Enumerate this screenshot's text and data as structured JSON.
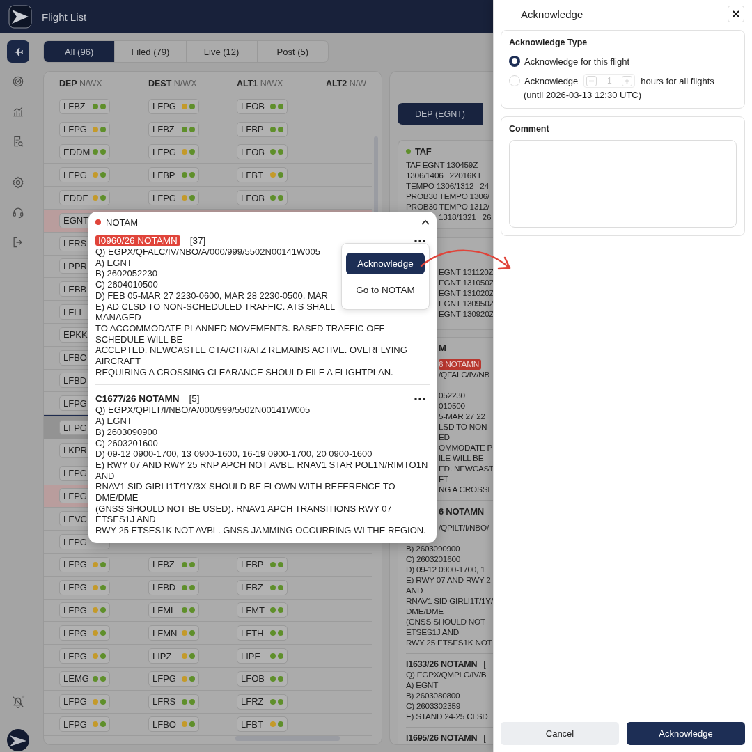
{
  "app": {
    "title": "Flight List"
  },
  "sidebar": {
    "items": [
      {
        "selected": true
      },
      {
        "selected": false
      },
      {
        "selected": false
      },
      {
        "selected": false
      },
      {
        "selected": false
      },
      {
        "selected": false
      },
      {
        "selected": false
      }
    ]
  },
  "filter_tabs": [
    {
      "label": "All (96)",
      "selected": true
    },
    {
      "label": "Filed (79)",
      "selected": false
    },
    {
      "label": "Live (12)",
      "selected": false
    },
    {
      "label": "Post (5)",
      "selected": false
    }
  ],
  "table": {
    "columns": [
      {
        "label": "DEP",
        "sub": "N/WX"
      },
      {
        "label": "DEST",
        "sub": "N/WX"
      },
      {
        "label": "ALT1",
        "sub": "N/WX"
      },
      {
        "label": "ALT2",
        "sub": "N/W"
      }
    ],
    "rows": [
      {
        "kind": "flight",
        "flagged": false,
        "selected": false,
        "cells": [
          {
            "code": "LFBZ",
            "dots": [
              {
                "color": "#5f8f2b"
              },
              {
                "color": "#5f8f2b"
              }
            ]
          },
          {
            "code": "LFPG",
            "dots": [
              {
                "color": "#c49a2a"
              },
              {
                "color": "#5f8f2b"
              }
            ]
          },
          {
            "code": "LFOB",
            "dots": [
              {
                "color": "#5f8f2b"
              },
              {
                "color": "#5f8f2b"
              }
            ]
          }
        ]
      },
      {
        "kind": "flight",
        "flagged": false,
        "selected": false,
        "cells": [
          {
            "code": "LFPG",
            "dots": [
              {
                "color": "#c49a2a"
              },
              {
                "color": "#5f8f2b"
              }
            ]
          },
          {
            "code": "LFBZ",
            "dots": [
              {
                "color": "#5f8f2b"
              },
              {
                "color": "#5f8f2b"
              }
            ]
          },
          {
            "code": "LFBP",
            "dots": [
              {
                "color": "#5f8f2b"
              },
              {
                "color": "#5f8f2b"
              }
            ]
          }
        ]
      },
      {
        "kind": "flight",
        "flagged": false,
        "selected": false,
        "cells": [
          {
            "code": "EDDM",
            "dots": [
              {
                "color": "#5f8f2b"
              },
              {
                "color": "#5f8f2b"
              }
            ]
          },
          {
            "code": "LFPG",
            "dots": [
              {
                "color": "#c49a2a"
              },
              {
                "color": "#5f8f2b"
              }
            ]
          },
          {
            "code": "LFOB",
            "dots": [
              {
                "color": "#5f8f2b"
              },
              {
                "color": "#5f8f2b"
              }
            ]
          }
        ]
      },
      {
        "kind": "flight",
        "flagged": false,
        "selected": false,
        "cells": [
          {
            "code": "LFPG",
            "dots": [
              {
                "color": "#c49a2a"
              },
              {
                "color": "#5f8f2b"
              }
            ]
          },
          {
            "code": "LFBP",
            "dots": [
              {
                "color": "#5f8f2b"
              },
              {
                "color": "#5f8f2b"
              }
            ]
          },
          {
            "code": "LFBT",
            "dots": [
              {
                "color": "#c49a2a"
              },
              {
                "color": "#5f8f2b"
              }
            ]
          }
        ]
      },
      {
        "kind": "flight",
        "flagged": false,
        "selected": false,
        "cells": [
          {
            "code": "EDDF",
            "dots": [
              {
                "color": "#c49a2a"
              },
              {
                "color": "#5f8f2b"
              }
            ]
          },
          {
            "code": "LFPG",
            "dots": [
              {
                "color": "#c49a2a"
              },
              {
                "color": "#5f8f2b"
              }
            ]
          },
          {
            "code": "LFOB",
            "dots": [
              {
                "color": "#5f8f2b"
              },
              {
                "color": "#5f8f2b"
              }
            ]
          }
        ]
      },
      {
        "kind": "flight",
        "flagged": true,
        "selected": false,
        "cells": [
          {
            "code": "EGNT"
          }
        ]
      },
      {
        "kind": "flight",
        "flagged": false,
        "selected": false,
        "cells": [
          {
            "code": "LFRS"
          }
        ]
      },
      {
        "kind": "flight",
        "flagged": false,
        "selected": false,
        "cells": [
          {
            "code": "LPPR"
          }
        ]
      },
      {
        "kind": "flight",
        "flagged": false,
        "selected": false,
        "cells": [
          {
            "code": "LEBB"
          }
        ]
      },
      {
        "kind": "flight",
        "flagged": false,
        "selected": false,
        "cells": [
          {
            "code": "LFLL"
          }
        ]
      },
      {
        "kind": "flight",
        "flagged": false,
        "selected": false,
        "cells": [
          {
            "code": "EPKK"
          }
        ]
      },
      {
        "kind": "flight",
        "flagged": false,
        "selected": false,
        "cells": [
          {
            "code": "LFBO"
          }
        ]
      },
      {
        "kind": "flight",
        "flagged": false,
        "selected": false,
        "cells": [
          {
            "code": "LFBD"
          }
        ]
      },
      {
        "kind": "flight",
        "flagged": false,
        "selected": false,
        "cells": [
          {
            "code": "LFPG"
          }
        ]
      },
      {
        "kind": "now-line"
      },
      {
        "kind": "flight",
        "flagged": false,
        "selected": true,
        "cells": [
          {
            "code": "LFPG"
          }
        ]
      },
      {
        "kind": "flight",
        "flagged": false,
        "selected": false,
        "cells": [
          {
            "code": "LKPR"
          }
        ]
      },
      {
        "kind": "flight",
        "flagged": false,
        "selected": false,
        "cells": [
          {
            "code": "LFPG"
          }
        ]
      },
      {
        "kind": "flight",
        "flagged": true,
        "selected": false,
        "cells": [
          {
            "code": "LFPG"
          }
        ]
      },
      {
        "kind": "flight",
        "flagged": false,
        "selected": false,
        "cells": [
          {
            "code": "LEVC"
          }
        ]
      },
      {
        "kind": "flight",
        "flagged": false,
        "selected": false,
        "cells": [
          {
            "code": "LFPG"
          }
        ]
      },
      {
        "kind": "flight",
        "flagged": false,
        "selected": false,
        "cells": [
          {
            "code": "LFPG",
            "dots": [
              {
                "color": "#c49a2a"
              },
              {
                "color": "#5f8f2b"
              }
            ]
          },
          {
            "code": "LFBZ",
            "dots": [
              {
                "color": "#5f8f2b"
              },
              {
                "color": "#5f8f2b"
              }
            ]
          },
          {
            "code": "LFBP",
            "dots": [
              {
                "color": "#5f8f2b"
              },
              {
                "color": "#5f8f2b"
              }
            ]
          }
        ]
      },
      {
        "kind": "flight",
        "flagged": false,
        "selected": false,
        "cells": [
          {
            "code": "LFPG",
            "dots": [
              {
                "color": "#c49a2a"
              },
              {
                "color": "#5f8f2b"
              }
            ]
          },
          {
            "code": "LFBD",
            "dots": [
              {
                "color": "#5f8f2b"
              },
              {
                "color": "#5f8f2b"
              }
            ]
          },
          {
            "code": "LFBZ",
            "dots": [
              {
                "color": "#5f8f2b"
              },
              {
                "color": "#5f8f2b"
              }
            ]
          }
        ]
      },
      {
        "kind": "flight",
        "flagged": false,
        "selected": false,
        "cells": [
          {
            "code": "LFPG",
            "dots": [
              {
                "color": "#c49a2a"
              },
              {
                "color": "#5f8f2b"
              }
            ]
          },
          {
            "code": "LFML",
            "dots": [
              {
                "color": "#5f8f2b"
              },
              {
                "color": "#5f8f2b"
              }
            ]
          },
          {
            "code": "LFMT",
            "dots": [
              {
                "color": "#5f8f2b"
              },
              {
                "color": "#5f8f2b"
              }
            ]
          }
        ]
      },
      {
        "kind": "flight",
        "flagged": false,
        "selected": false,
        "cells": [
          {
            "code": "LFPG",
            "dots": [
              {
                "color": "#c49a2a"
              },
              {
                "color": "#5f8f2b"
              }
            ]
          },
          {
            "code": "LFMN",
            "dots": [
              {
                "color": "#c49a2a"
              },
              {
                "color": "#5f8f2b"
              }
            ]
          },
          {
            "code": "LFTH",
            "dots": [
              {
                "color": "#5f8f2b"
              },
              {
                "color": "#5f8f2b"
              }
            ]
          }
        ]
      },
      {
        "kind": "flight",
        "flagged": false,
        "selected": false,
        "cells": [
          {
            "code": "LFPG",
            "dots": [
              {
                "color": "#c49a2a"
              },
              {
                "color": "#5f8f2b"
              }
            ]
          },
          {
            "code": "LIPZ",
            "dots": [
              {
                "color": "#c49a2a"
              },
              {
                "color": "#5f8f2b"
              }
            ]
          },
          {
            "code": "LIPE",
            "dots": [
              {
                "color": "#5f8f2b"
              },
              {
                "color": "#5f8f2b"
              }
            ]
          }
        ]
      },
      {
        "kind": "flight",
        "flagged": false,
        "selected": false,
        "cells": [
          {
            "code": "LEMG",
            "dots": [
              {
                "color": "#5f8f2b"
              },
              {
                "color": "#5f8f2b"
              }
            ]
          },
          {
            "code": "LFPG",
            "dots": [
              {
                "color": "#c49a2a"
              },
              {
                "color": "#5f8f2b"
              }
            ]
          },
          {
            "code": "LFOB",
            "dots": [
              {
                "color": "#5f8f2b"
              },
              {
                "color": "#5f8f2b"
              }
            ]
          }
        ]
      },
      {
        "kind": "flight",
        "flagged": false,
        "selected": false,
        "cells": [
          {
            "code": "LFPG",
            "dots": [
              {
                "color": "#c49a2a"
              },
              {
                "color": "#5f8f2b"
              }
            ]
          },
          {
            "code": "LFRS",
            "dots": [
              {
                "color": "#5f8f2b"
              },
              {
                "color": "#5f8f2b"
              }
            ]
          },
          {
            "code": "LFRZ",
            "dots": [
              {
                "color": "#5f8f2b"
              },
              {
                "color": "#5f8f2b"
              }
            ]
          }
        ]
      },
      {
        "kind": "flight",
        "flagged": false,
        "selected": false,
        "cells": [
          {
            "code": "LFPG",
            "dots": [
              {
                "color": "#c49a2a"
              },
              {
                "color": "#5f8f2b"
              }
            ]
          },
          {
            "code": "LFBO",
            "dots": [
              {
                "color": "#c49a2a"
              },
              {
                "color": "#5f8f2b"
              }
            ]
          },
          {
            "code": "LFBT",
            "dots": [
              {
                "color": "#c49a2a"
              },
              {
                "color": "#5f8f2b"
              }
            ]
          }
        ]
      }
    ]
  },
  "detail": {
    "tabs": [
      {
        "label": "DEP (EGNT)",
        "selected": true
      }
    ],
    "cards": [
      {
        "kind": "taf",
        "title": "TAF",
        "color": "#5f8f2b",
        "lines": [
          {
            "kind": "text",
            "text": "TAF EGNT 130459Z"
          },
          {
            "kind": "text",
            "text": "1306/1406   22016KT"
          },
          {
            "kind": "text",
            "text": "TEMPO 1306/1312   24"
          },
          {
            "kind": "text",
            "text": "PROB30 TEMPO 1306/"
          },
          {
            "kind": "text",
            "text": "PROB30 TEMPO 1312/"
          },
          {
            "kind": "partial",
            "text": "1318/1321   26"
          }
        ]
      },
      {
        "kind": "metar",
        "lines": [
          {
            "kind": "partial",
            "text": "EGNT 131120Z"
          },
          {
            "kind": "partial",
            "text": "EGNT 131050Z"
          },
          {
            "kind": "partial",
            "text": "EGNT 131020Z"
          },
          {
            "kind": "partial",
            "text": "EGNT 130950Z"
          },
          {
            "kind": "partial",
            "text": "EGNT 130920Z"
          }
        ]
      },
      {
        "kind": "notam",
        "lines": [
          {
            "kind": "partial-title",
            "text": "M"
          },
          {
            "kind": "partial-badge",
            "text": "6 NOTAMN"
          },
          {
            "kind": "partial",
            "text": "/QFALC/IV/NB"
          },
          {
            "kind": "partial",
            "text": "052230",
            "gap_before": true
          },
          {
            "kind": "partial",
            "text": "010500"
          },
          {
            "kind": "partial",
            "text": "5-MAR 27 22"
          },
          {
            "kind": "partial",
            "text": "LSD TO NON-"
          },
          {
            "kind": "partial",
            "text": "ED"
          },
          {
            "kind": "partial",
            "text": "OMMODATE P"
          },
          {
            "kind": "partial",
            "text": "ILE WILL BE"
          },
          {
            "kind": "partial",
            "text": "ED. NEWCAST"
          },
          {
            "kind": "partial",
            "text": "FT"
          },
          {
            "kind": "partial",
            "text": "NG A CROSSI"
          },
          {
            "kind": "rule"
          },
          {
            "kind": "partial-title",
            "text": "6 NOTAMN"
          },
          {
            "kind": "partial",
            "text": "/QPILT/I/NBO/"
          },
          {
            "kind": "text",
            "text": "B) 2603090900",
            "gap_before": true
          },
          {
            "kind": "text",
            "text": "C) 2603201600"
          },
          {
            "kind": "text",
            "text": "D) 09-12 0900-1700, 1"
          },
          {
            "kind": "text",
            "text": "E) RWY 07 AND RWY 2"
          },
          {
            "kind": "text",
            "text": "AND"
          },
          {
            "kind": "text",
            "text": "RNAV1 SID GIRLI1T/1Y/"
          },
          {
            "kind": "text",
            "text": "DME/DME"
          },
          {
            "kind": "text",
            "text": "(GNSS SHOULD NOT"
          },
          {
            "kind": "text",
            "text": "ETSES1J AND"
          },
          {
            "kind": "text",
            "text": "RWY 25 ETSES1K NOT"
          },
          {
            "kind": "rule"
          },
          {
            "kind": "title",
            "text": "I1633/26 NOTAMN",
            "count": "["
          },
          {
            "kind": "text",
            "text": "Q) EGPX/QMPLC/IV/B"
          },
          {
            "kind": "text",
            "text": "A) EGNT"
          },
          {
            "kind": "text",
            "text": "B) 2603080800"
          },
          {
            "kind": "text",
            "text": "C) 2603302359"
          },
          {
            "kind": "text",
            "text": "E) STAND 24-25 CLSD"
          },
          {
            "kind": "rule"
          },
          {
            "kind": "title",
            "text": "I1695/26 NOTAMN",
            "count": "["
          }
        ]
      }
    ]
  },
  "notam_popup": {
    "title": "NOTAM",
    "color": "#e0443a",
    "expanded": true,
    "entries": [
      {
        "id_label": "I0960/26 NOTAMN",
        "count": "[37]",
        "highlighted": true,
        "lines": [
          "Q) EGPX/QFALC/IV/NBO/A/000/999/5502N00141W005",
          "A) EGNT",
          "B) 2602052230",
          "C) 2604010500",
          "D) FEB 05-MAR 27 2230-0600, MAR 28 2230-0500, MAR",
          "E) AD CLSD TO NON-SCHEDULED TRAFFIC. ATS SHALL",
          "MANAGED",
          "TO ACCOMMODATE PLANNED MOVEMENTS. BASED TRAFFIC OFF",
          "SCHEDULE WILL BE",
          "ACCEPTED. NEWCASTLE CTA/CTR/ATZ REMAINS ACTIVE. OVERFLYING",
          "AIRCRAFT",
          "REQUIRING A CROSSING CLEARANCE SHOULD FILE A FLIGHTPLAN."
        ],
        "menu": [
          {
            "label": "Acknowledge",
            "selected": true
          },
          {
            "label": "Go to NOTAM",
            "selected": false
          }
        ]
      },
      {
        "id_label": "C1677/26 NOTAMN",
        "count": "[5]",
        "highlighted": false,
        "lines": [
          "Q) EGPX/QPILT/I/NBO/A/000/999/5502N00141W005",
          "A) EGNT",
          "B) 2603090900",
          "C) 2603201600",
          "D) 09-12 0900-1700, 13 0900-1600, 16-19 0900-1700, 20 0900-1600",
          "E) RWY 07 AND RWY 25 RNP APCH NOT AVBL. RNAV1 STAR POL1N/RIMTO1N",
          "AND",
          "RNAV1 SID GIRLI1T/1Y/3X SHOULD BE FLOWN WITH REFERENCE TO",
          "DME/DME",
          "(GNSS SHOULD NOT BE USED). RNAV1 APCH TRANSITIONS RWY 07",
          "ETSES1J AND",
          "RWY 25 ETSES1K NOT AVBL. GNSS JAMMING OCCURRING WI THE REGION."
        ]
      }
    ]
  },
  "drawer": {
    "title": "Acknowledge",
    "type_section": {
      "title": "Acknowledge Type",
      "options": [
        {
          "kind": "simple",
          "label": "Acknowledge for this flight",
          "selected": true
        },
        {
          "kind": "hours",
          "label": "Acknowledge",
          "stepper": {
            "value": "1",
            "disabled": true
          },
          "suffix": "hours for all flights",
          "note": "(until 2026-03-13 12:30 UTC)",
          "selected": false
        }
      ]
    },
    "comment": {
      "title": "Comment"
    },
    "buttons": [
      {
        "label": "Cancel",
        "kind": "secondary"
      },
      {
        "label": "Acknowledge",
        "kind": "primary"
      }
    ]
  }
}
